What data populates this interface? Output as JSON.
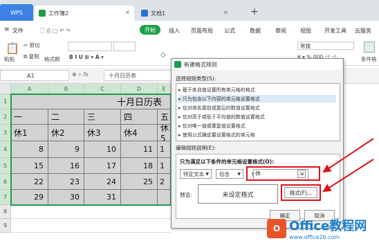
{
  "titlebar": {
    "wps_label": "WPS",
    "tabs": [
      {
        "label": "工作簿2",
        "icon": "spreadsheet-icon",
        "color": "#1e9e4a"
      },
      {
        "label": "文档1",
        "icon": "document-icon",
        "color": "#2b6fd6"
      }
    ],
    "new_tab": "+"
  },
  "menu": {
    "file": "文件",
    "start": "开始",
    "items": [
      "插入",
      "页面布局",
      "公式",
      "数据",
      "审阅",
      "视图",
      "开发工具",
      "云服务"
    ]
  },
  "toolbar": {
    "cut": "剪切",
    "copy": "复制",
    "paste": "粘贴",
    "format_painter": "格式刷",
    "number_format": "常规",
    "cond_format": "条件格"
  },
  "formula_bar": {
    "cell_ref": "A1",
    "fx": "fx",
    "value": "十月日历表"
  },
  "sheet": {
    "columns": [
      "A",
      "B",
      "C",
      "D",
      "E"
    ],
    "rows": [
      "1",
      "2",
      "3",
      "4",
      "5",
      "6",
      "7",
      "8",
      "9"
    ],
    "title": "十月日历表",
    "row2": [
      "一",
      "二",
      "三",
      "四",
      "五"
    ],
    "row3": [
      "休1",
      "休2",
      "休3",
      "休4",
      "休5"
    ],
    "row4": [
      "8",
      "9",
      "10",
      "11",
      "1"
    ],
    "row5": [
      "15",
      "16",
      "17",
      "18",
      "1"
    ],
    "row6": [
      "22",
      "23",
      "24",
      "25",
      "2"
    ],
    "row7": [
      "29",
      "30",
      "31",
      "",
      ""
    ]
  },
  "dialog": {
    "title": "新建格式规则",
    "rule_type_label": "选择规则类型(S):",
    "rules": [
      "基于各自值设置所有单元格的格式",
      "只为包含以下内容的单元格设置格式",
      "仅对排名靠前或靠后的数值设置格式",
      "仅对高于或低于平均值的数值设置格式",
      "仅对唯一值或重复值设置格式",
      "使用公式确定要设置格式的单元格"
    ],
    "selected_rule_index": 1,
    "desc_label": "编辑规则说明(E):",
    "condition_label": "只为满足以下条件的单元格设置格式(O):",
    "condition_type": "特定文本",
    "operator": "包含",
    "value": "休",
    "preview_label": "预览:",
    "preview_text": "未设定格式",
    "format_button": "格式(F)...",
    "ok_button": "确定",
    "cancel_button": "取消"
  },
  "watermark": {
    "text": "Office教程网",
    "url": "www.office26.com"
  },
  "colors": {
    "accent_green": "#1e9e4a",
    "highlight_red": "#e0101a",
    "wps_blue": "#3c82e5"
  }
}
